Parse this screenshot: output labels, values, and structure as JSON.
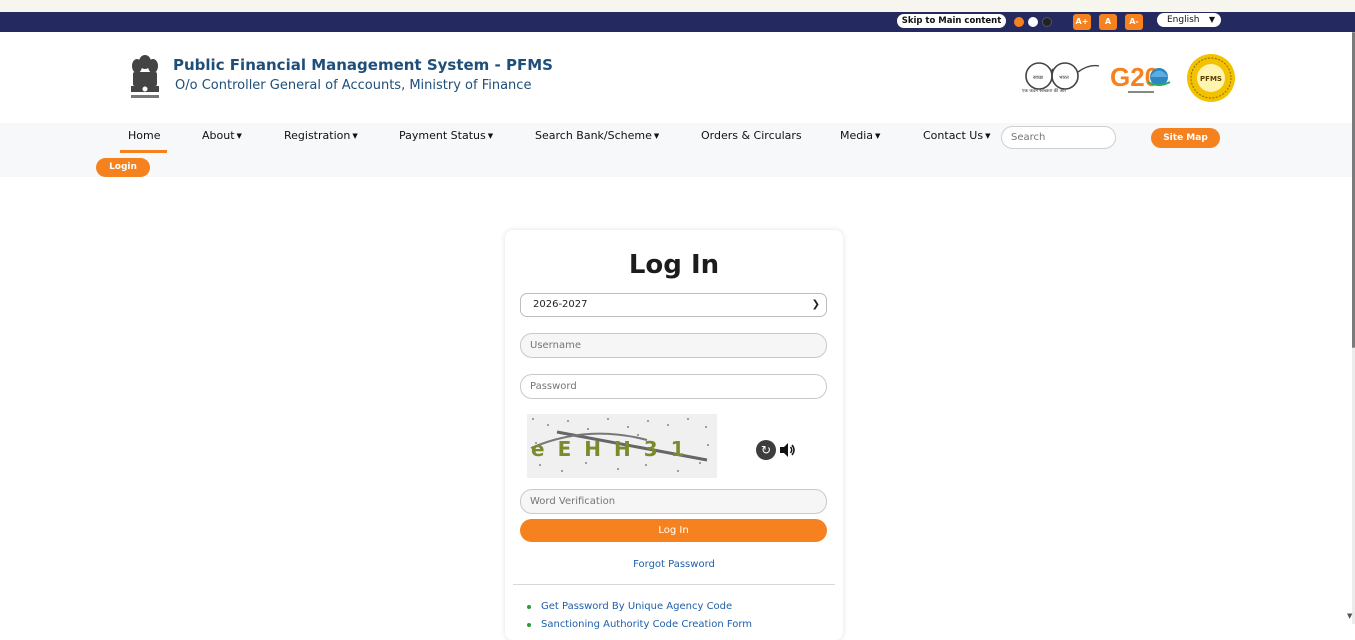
{
  "topbar": {
    "skip_label": "Skip to Main content",
    "theme_colors": [
      "#f5821f",
      "#ffffff",
      "#222222"
    ],
    "font_increase": "A+",
    "font_normal": "A",
    "font_decrease": "A-",
    "language": "English"
  },
  "header": {
    "title": "Public Financial Management System - PFMS",
    "subtitle": "O/o Controller General of Accounts, Ministry of Finance",
    "emblem_caption": "सत्यमेव जयते",
    "swachh_caption": "एक कदम स्वच्छता की ओर",
    "g20_label": "G20",
    "seal_label": "PFMS"
  },
  "nav": {
    "items": [
      {
        "label": "Home",
        "dropdown": false
      },
      {
        "label": "About",
        "dropdown": true
      },
      {
        "label": "Registration",
        "dropdown": true
      },
      {
        "label": "Payment Status",
        "dropdown": true
      },
      {
        "label": "Search Bank/Scheme",
        "dropdown": true
      },
      {
        "label": "Orders & Circulars",
        "dropdown": false
      },
      {
        "label": "Media",
        "dropdown": true
      },
      {
        "label": "Contact Us",
        "dropdown": true
      }
    ],
    "search_placeholder": "Search",
    "site_map_label": "Site Map",
    "login_label": "Login"
  },
  "login_card": {
    "title": "Log In",
    "financial_year": "2026-2027",
    "username_placeholder": "Username",
    "password_placeholder": "Password",
    "captcha_text": "eEHH31",
    "word_verification_placeholder": "Word Verification",
    "submit_label": "Log In",
    "forgot_password": "Forgot Password",
    "links": [
      "Get Password By Unique Agency Code",
      "Sanctioning Authority Code Creation Form"
    ]
  },
  "colors": {
    "accent": "#f5821f",
    "topbar": "#242a5f",
    "title": "#1f4e79",
    "link": "#1f5fa8"
  }
}
